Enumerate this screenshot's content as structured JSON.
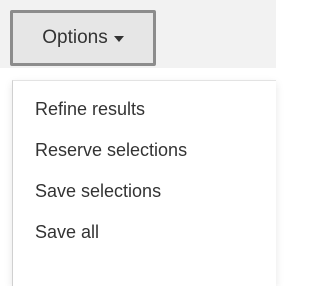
{
  "toolbar": {
    "options_label": "Options",
    "options_icon": "caret-down-icon"
  },
  "menu": {
    "items": [
      {
        "label": "Refine results"
      },
      {
        "label": "Reserve selections"
      },
      {
        "label": "Save selections"
      },
      {
        "label": "Save all"
      }
    ]
  },
  "colors": {
    "toolbar_bg": "#f2f2f2",
    "button_bg": "#e6e6e6",
    "button_border": "#8c8c8c",
    "text": "#333333",
    "menu_bg": "#ffffff"
  }
}
